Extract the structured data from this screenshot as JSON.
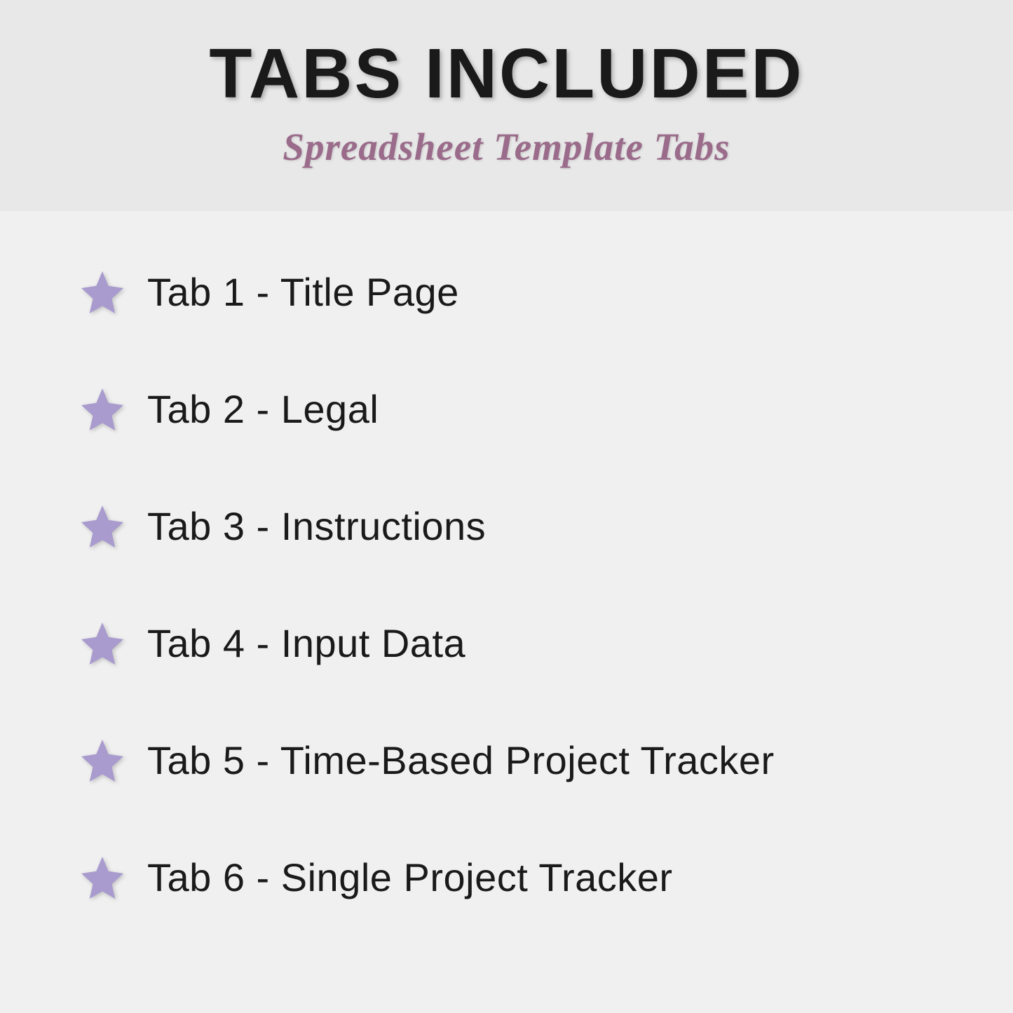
{
  "header": {
    "title": "TABS INCLUDED",
    "subtitle": "Spreadsheet Template Tabs"
  },
  "items": [
    {
      "label": "Tab 1 - Title Page"
    },
    {
      "label": "Tab 2 - Legal"
    },
    {
      "label": "Tab 3 - Instructions"
    },
    {
      "label": "Tab 4 - Input Data"
    },
    {
      "label": "Tab 5 - Time-Based Project Tracker"
    },
    {
      "label": "Tab 6 - Single Project Tracker"
    }
  ],
  "colors": {
    "star": "#a99bce",
    "subtitle": "#9a6b8a",
    "header_bg": "#e8e8e8",
    "body_bg": "#f0f0f0",
    "text": "#1a1a1a"
  }
}
